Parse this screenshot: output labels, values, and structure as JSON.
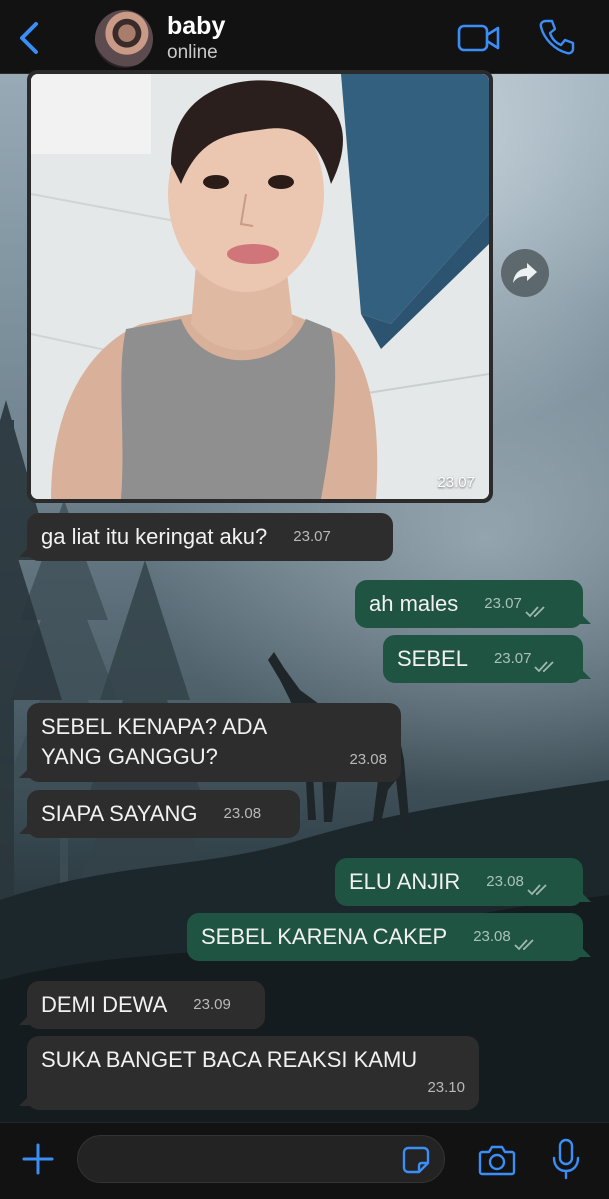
{
  "header": {
    "contact_name": "baby",
    "status": "online",
    "icons": [
      "back-chevron-icon",
      "video-call-icon",
      "phone-icon"
    ]
  },
  "photo_message": {
    "time": "23.07",
    "forward_icon": "forward-icon"
  },
  "messages": [
    {
      "dir": "in",
      "text": "ga liat itu keringat aku?",
      "time": "23.07"
    },
    {
      "dir": "out",
      "text": "ah males",
      "time": "23.07"
    },
    {
      "dir": "out",
      "text": "SEBEL",
      "time": "23.07"
    },
    {
      "dir": "in",
      "text": "SEBEL KENAPA? ADA YANG GANGGU?",
      "time": "23.08"
    },
    {
      "dir": "in",
      "text": "SIAPA SAYANG",
      "time": "23.08"
    },
    {
      "dir": "out",
      "text": "ELU ANJIR",
      "time": "23.08"
    },
    {
      "dir": "out",
      "text": "SEBEL KARENA CAKEP",
      "time": "23.08"
    },
    {
      "dir": "in",
      "text": "DEMI DEWA",
      "time": "23.09"
    },
    {
      "dir": "in",
      "text": "SUKA BANGET BACA REAKSI KAMU",
      "time": "23.10"
    }
  ],
  "input_bar": {
    "placeholder": "",
    "icons": [
      "plus-icon",
      "sticker-icon",
      "camera-icon",
      "microphone-icon"
    ]
  },
  "colors": {
    "accent": "#3a8ef6",
    "incoming_bubble": "#2d2d2d",
    "outgoing_bubble": "#1f5443",
    "read_ticks": "#9fb8ae"
  }
}
